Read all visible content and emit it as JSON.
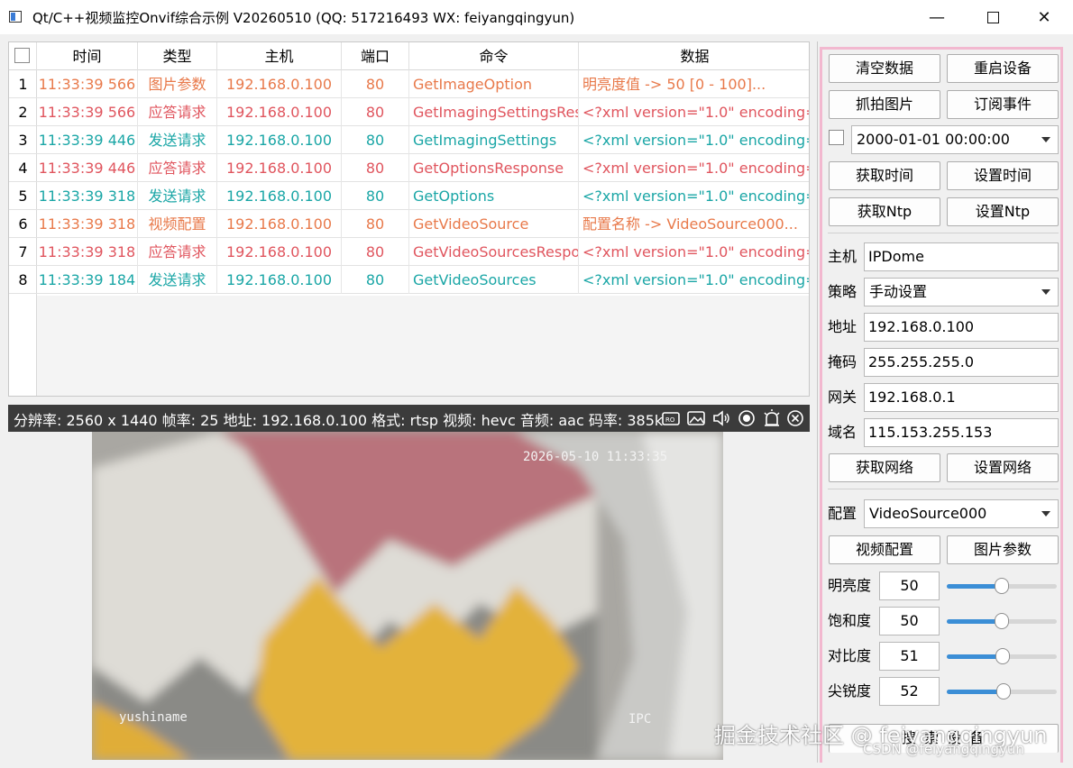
{
  "window": {
    "title": "Qt/C++视频监控Onvif综合示例 V20260510 (QQ: 517216493 WX: feiyangqingyun)",
    "minimize": "—",
    "close": "✕"
  },
  "table": {
    "headers": [
      "时间",
      "类型",
      "主机",
      "端口",
      "命令",
      "数据"
    ],
    "rows": [
      {
        "num": "1",
        "time": "11:33:39 566",
        "type": "图片参数",
        "host": "192.168.0.100",
        "port": "80",
        "cmd": "GetImageOption",
        "data": "明亮度值 -> 50 [0 - 100]...",
        "color": "#e8794a"
      },
      {
        "num": "2",
        "time": "11:33:39 566",
        "type": "应答请求",
        "host": "192.168.0.100",
        "port": "80",
        "cmd": "GetImagingSettingsRes",
        "data": "<?xml version=\"1.0\" encoding=\"",
        "color": "#e0555e"
      },
      {
        "num": "3",
        "time": "11:33:39 446",
        "type": "发送请求",
        "host": "192.168.0.100",
        "port": "80",
        "cmd": "GetImagingSettings",
        "data": "<?xml version=\"1.0\" encoding=\"",
        "color": "#1aa6a6"
      },
      {
        "num": "4",
        "time": "11:33:39 446",
        "type": "应答请求",
        "host": "192.168.0.100",
        "port": "80",
        "cmd": "GetOptionsResponse",
        "data": "<?xml version=\"1.0\" encoding=\"",
        "color": "#e0555e"
      },
      {
        "num": "5",
        "time": "11:33:39 318",
        "type": "发送请求",
        "host": "192.168.0.100",
        "port": "80",
        "cmd": "GetOptions",
        "data": "<?xml version=\"1.0\" encoding=\"",
        "color": "#1aa6a6"
      },
      {
        "num": "6",
        "time": "11:33:39 318",
        "type": "视频配置",
        "host": "192.168.0.100",
        "port": "80",
        "cmd": "GetVideoSource",
        "data": "配置名称 -> VideoSource000...",
        "color": "#e8794a"
      },
      {
        "num": "7",
        "time": "11:33:39 318",
        "type": "应答请求",
        "host": "192.168.0.100",
        "port": "80",
        "cmd": "GetVideoSourcesRespo",
        "data": "<?xml version=\"1.0\" encoding=\"",
        "color": "#e0555e"
      },
      {
        "num": "8",
        "time": "11:33:39 184",
        "type": "发送请求",
        "host": "192.168.0.100",
        "port": "80",
        "cmd": "GetVideoSources",
        "data": "<?xml version=\"1.0\" encoding=\"",
        "color": "#1aa6a6"
      }
    ]
  },
  "video": {
    "info": "分辨率: 2560 x 1440  帧率: 25  地址: 192.168.0.100  格式: rtsp  视频: hevc  音频: aac  码率: 385kb",
    "osd_time": "2026-05-10 11:33:35",
    "osd_name": "yushiname",
    "osd_ipc": "IPC",
    "icons": [
      "record-icon",
      "snapshot-icon",
      "volume-icon",
      "stream-icon",
      "alarm-icon",
      "close-icon"
    ]
  },
  "panel": {
    "btn_clear": "清空数据",
    "btn_reboot": "重启设备",
    "btn_snap": "抓拍图片",
    "btn_subscribe": "订阅事件",
    "datetime": "2000-01-01 00:00:00",
    "btn_get_time": "获取时间",
    "btn_set_time": "设置时间",
    "btn_get_ntp": "获取Ntp",
    "btn_set_ntp": "设置Ntp",
    "host_label": "主机",
    "host_value": "IPDome",
    "policy_label": "策略",
    "policy_value": "手动设置",
    "addr_label": "地址",
    "addr_value": "192.168.0.100",
    "mask_label": "掩码",
    "mask_value": "255.255.255.0",
    "gateway_label": "网关",
    "gateway_value": "192.168.0.1",
    "dns_label": "域名",
    "dns_value": "115.153.255.153",
    "btn_get_net": "获取网络",
    "btn_set_net": "设置网络",
    "config_label": "配置",
    "config_value": "VideoSource000",
    "btn_video_cfg": "视频配置",
    "btn_image_param": "图片参数",
    "sliders": [
      {
        "label": "明亮度",
        "value": "50",
        "level": 0.5
      },
      {
        "label": "饱和度",
        "value": "50",
        "level": 0.5
      },
      {
        "label": "对比度",
        "value": "51",
        "level": 0.51
      },
      {
        "label": "尖锐度",
        "value": "52",
        "level": 0.52
      }
    ],
    "bottom_partial": "搜 索 设 备"
  },
  "watermark": {
    "main": "掘金技术社区 @ feiyangqingyun",
    "sub": "CSDN @feiyangqingyun"
  }
}
